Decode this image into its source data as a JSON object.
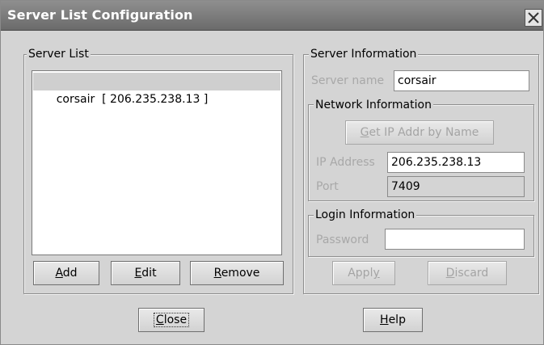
{
  "window": {
    "title": "Server List Configuration",
    "close_glyph": "✕",
    "close_icon": "close-icon"
  },
  "server_list": {
    "group_title": "Server List",
    "items": [
      {
        "label": "corsair  [ 206.235.238.13 ]",
        "selected": true
      }
    ],
    "buttons": {
      "add": {
        "mnemonic": "A",
        "rest": "dd"
      },
      "edit": {
        "mnemonic": "E",
        "rest": "dit"
      },
      "remove": {
        "mnemonic": "R",
        "rest": "emove"
      }
    }
  },
  "server_info": {
    "group_title": "Server Information",
    "server_name_label": "Server name",
    "server_name_value": "corsair",
    "network": {
      "group_title": "Network Information",
      "get_ip": {
        "pre": "",
        "mnemonic": "G",
        "rest": "et IP Addr by Name"
      },
      "ip_label": "IP Address",
      "ip_value": "206.235.238.13",
      "port_label": "Port",
      "port_value": "7409"
    },
    "login": {
      "group_title": "Login Information",
      "password_label": "Password",
      "password_value": ""
    },
    "apply": {
      "pre": "Appl",
      "mnemonic": "y",
      "rest": ""
    },
    "discard": {
      "pre": "",
      "mnemonic": "D",
      "rest": "iscard"
    }
  },
  "footer": {
    "close": {
      "pre": "",
      "mnemonic": "C",
      "rest": "lose"
    },
    "help": {
      "pre": "",
      "mnemonic": "H",
      "rest": "elp"
    }
  },
  "colors": {
    "titlebar": "#7b7b7b",
    "dialog_bg": "#d4d4d4",
    "selection": "#cfcfcf",
    "disabled_text": "#a8a8a8"
  }
}
